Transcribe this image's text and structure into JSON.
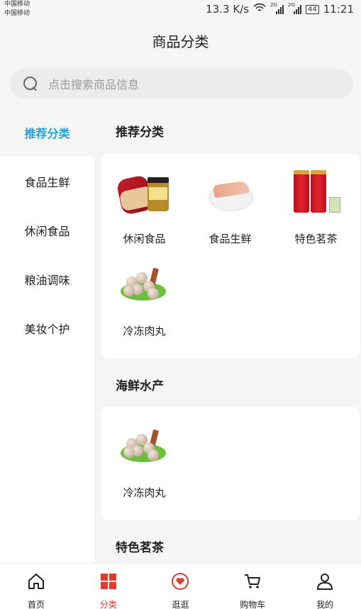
{
  "status_bar": {
    "carrier1": "中国移动",
    "carrier2": "中国移动",
    "speed": "13.3 K/s",
    "net1": "2G",
    "net2": "2G",
    "battery": "44",
    "time": "11:21"
  },
  "header": {
    "title": "商品分类"
  },
  "search": {
    "placeholder": "点击搜索商品信息"
  },
  "sidebar": {
    "items": [
      {
        "label": "推荐分类",
        "active": true
      },
      {
        "label": "食品生鲜"
      },
      {
        "label": "休闲食品"
      },
      {
        "label": "粮油调味"
      },
      {
        "label": "美妆个护"
      }
    ]
  },
  "sections": [
    {
      "title": "推荐分类",
      "items": [
        {
          "label": "休闲食品",
          "icon": "snack-gift-box-image"
        },
        {
          "label": "食品生鲜",
          "icon": "shrimp-plate-image"
        },
        {
          "label": "特色茗茶",
          "icon": "tea-cans-image"
        },
        {
          "label": "冷冻肉丸",
          "icon": "meatballs-image"
        }
      ]
    },
    {
      "title": "海鲜水产",
      "items": [
        {
          "label": "冷冻肉丸",
          "icon": "meatballs-image"
        }
      ]
    },
    {
      "title": "特色茗茶",
      "items": []
    }
  ],
  "tabbar": {
    "items": [
      {
        "label": "首页",
        "icon": "home-icon"
      },
      {
        "label": "分类",
        "icon": "category-grid-icon",
        "active": true
      },
      {
        "label": "逛逛",
        "icon": "heart-chat-icon"
      },
      {
        "label": "购物车",
        "icon": "cart-icon"
      },
      {
        "label": "我的",
        "icon": "user-icon"
      }
    ]
  },
  "colors": {
    "accent_blue": "#1aa3e0",
    "accent_red": "#e23a2b",
    "background": "#f5f5f5"
  }
}
